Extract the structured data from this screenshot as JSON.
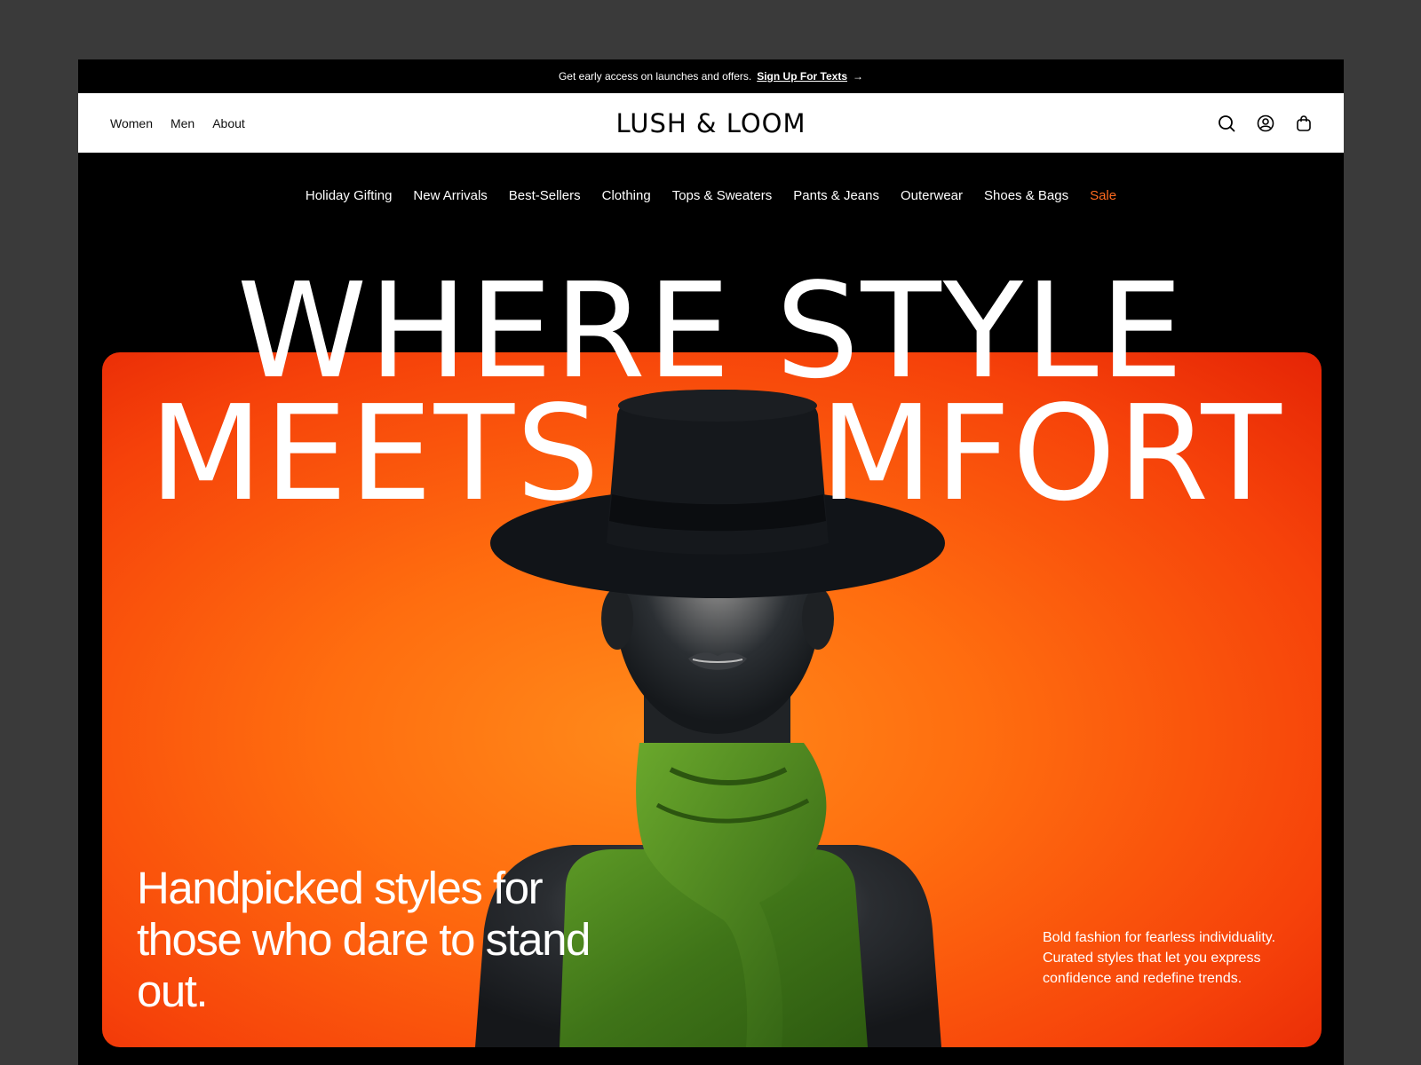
{
  "announcement": {
    "text": "Get early access on launches and offers.",
    "link": "Sign Up For Texts",
    "arrow": "→"
  },
  "header": {
    "left_nav": [
      "Women",
      "Men",
      "About"
    ],
    "logo": "LUSH & LOOM",
    "icons": [
      "search-icon",
      "account-icon",
      "bag-icon"
    ]
  },
  "category_nav": {
    "items": [
      "Holiday Gifting",
      "New Arrivals",
      "Best-Sellers",
      "Clothing",
      "Tops & Sweaters",
      "Pants & Jeans",
      "Outerwear",
      "Shoes & Bags"
    ],
    "sale": "Sale"
  },
  "hero": {
    "headline_line1": "WHERE STYLE",
    "headline_line2_a": "MEETS",
    "headline_line2_b": "MFORT",
    "tagline": "Handpicked styles for those who dare to stand out.",
    "blurb": "Bold fashion for fearless individuality. Curated styles that let you express confidence and redefine trends."
  },
  "colors": {
    "accent": "#ff6a1f",
    "hero_orange": "#ff7a12",
    "hero_red": "#e52405",
    "scarf_green": "#4f8a1e"
  }
}
